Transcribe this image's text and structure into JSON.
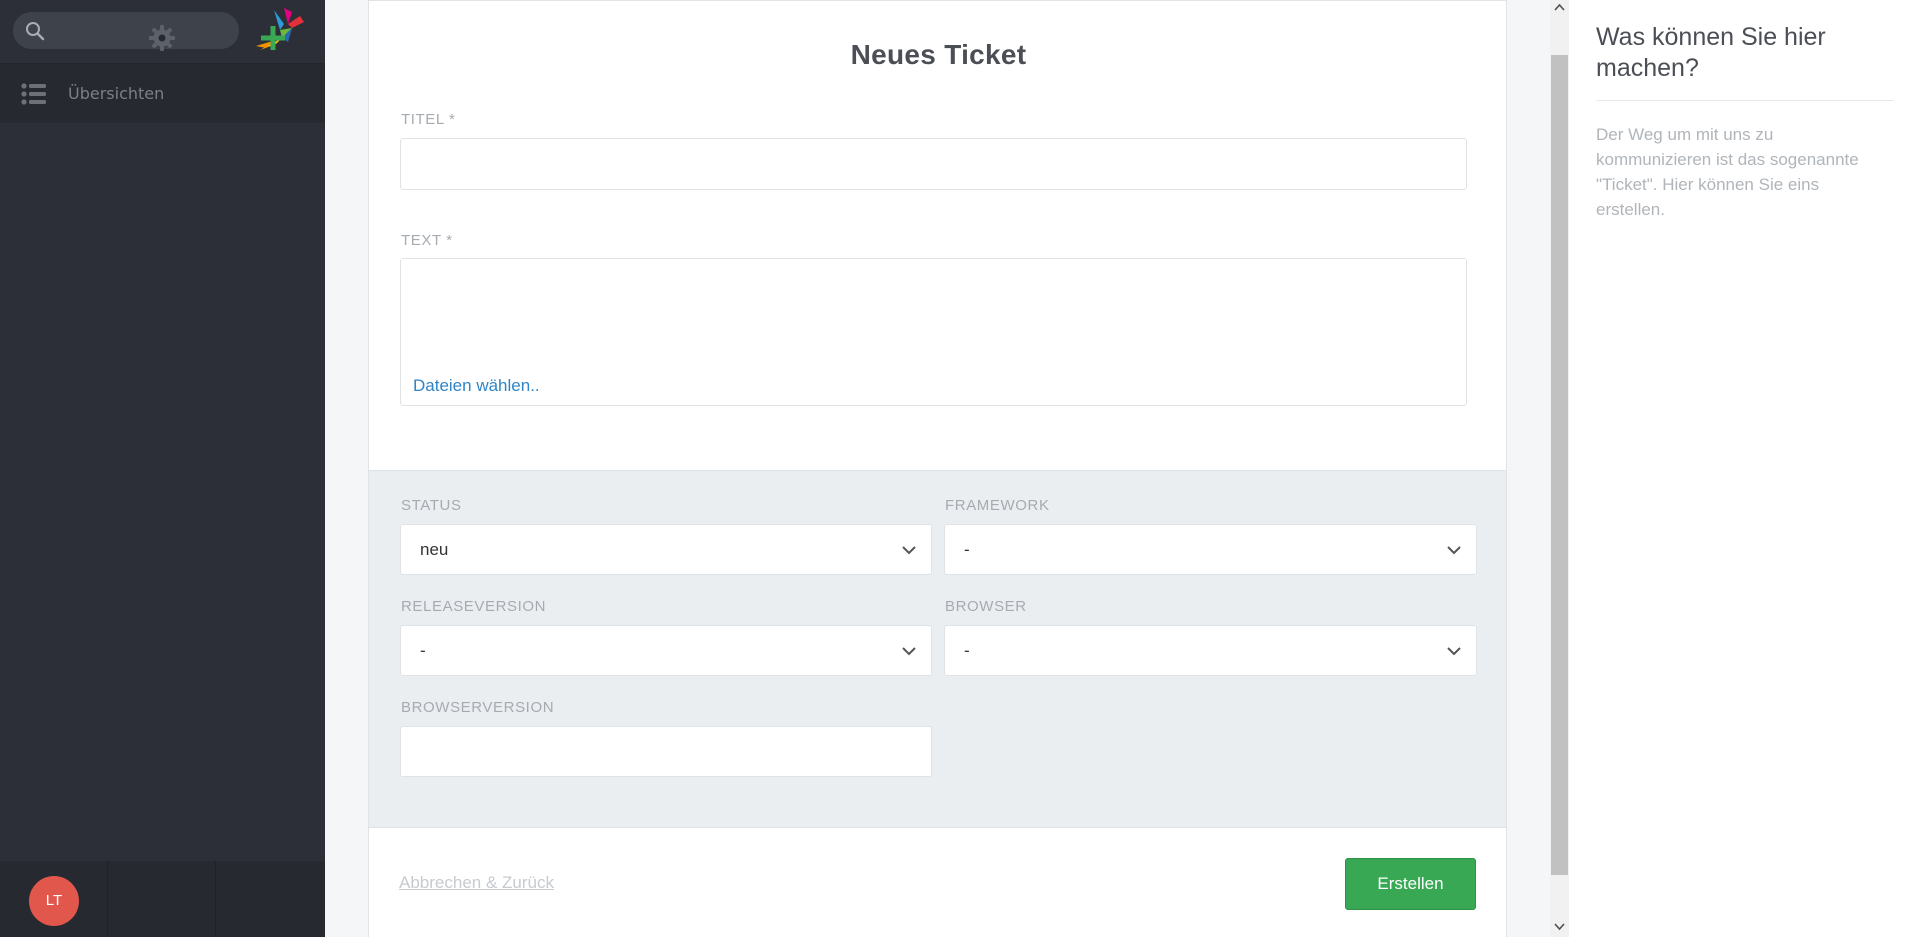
{
  "sidebar": {
    "search": {
      "placeholder": "",
      "value": ""
    },
    "nav": [
      {
        "label": "Übersichten",
        "icon": "list-icon"
      }
    ],
    "bottom": {
      "avatar_initials": "LT",
      "avatar_color": "#e2574c",
      "settings_icon": "gear-icon",
      "add_icon": "plus-icon",
      "add_color": "#38a855"
    }
  },
  "form": {
    "title": "Neues Ticket",
    "title_label": "TITEL *",
    "title_value": "",
    "text_label": "TEXT *",
    "text_value": "",
    "file_link": "Dateien wählen..",
    "attributes": {
      "status": {
        "label": "STATUS",
        "value": "neu"
      },
      "framework": {
        "label": "FRAMEWORK",
        "value": "-"
      },
      "releaseversion": {
        "label": "RELEASEVERSION",
        "value": "-"
      },
      "browser": {
        "label": "BROWSER",
        "value": "-"
      },
      "browserversion": {
        "label": "BROWSERVERSION",
        "value": ""
      }
    },
    "cancel_link": "Abbrechen & Zurück",
    "create_button": "Erstellen",
    "accent_color": "#38a855"
  },
  "help": {
    "title": "Was können Sie hier machen?",
    "text": "Der Weg um mit uns zu kommunizieren ist das sogenannte \"Ticket\". Hier können Sie eins erstellen."
  }
}
